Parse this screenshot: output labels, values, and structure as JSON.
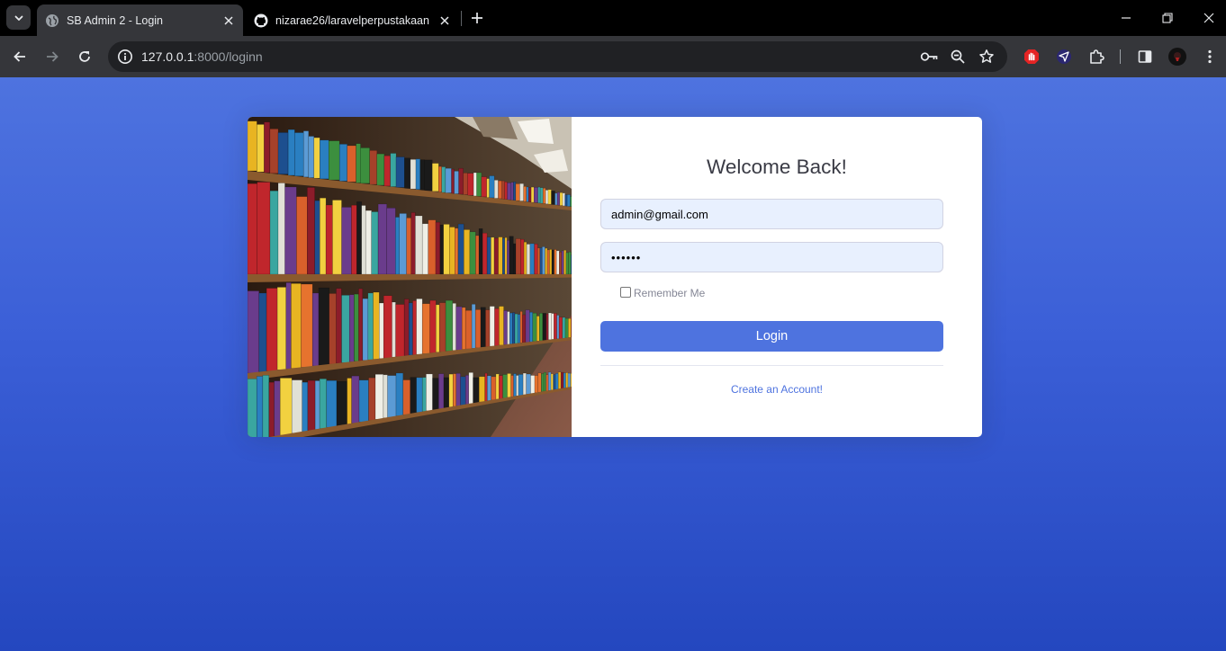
{
  "browser": {
    "tabs": [
      {
        "title": "SB Admin 2 - Login",
        "active": true,
        "favicon": "globe-icon"
      },
      {
        "title": "nizarae26/laravelperpustakaan",
        "active": false,
        "favicon": "github-icon"
      }
    ],
    "url": {
      "host": "127.0.0.1",
      "rest": ":8000/loginn"
    },
    "colors": {
      "frame": "#000000",
      "toolbar": "#35363a",
      "omnibox": "#202124"
    },
    "toolbar_icons": [
      "back-icon",
      "forward-icon",
      "reload-icon",
      "site-info-icon",
      "password-key-icon",
      "zoom-icon",
      "bookmark-star-icon",
      "adblock-extension-icon",
      "proton-vpn-extension-icon",
      "extensions-puzzle-icon",
      "side-panel-icon",
      "profile-avatar-icon",
      "more-menu-icon"
    ]
  },
  "login": {
    "heading": "Welcome Back!",
    "email_value": "admin@gmail.com",
    "password_value": "••••••",
    "remember_label": "Remember Me",
    "remember_checked": false,
    "login_button": "Login",
    "create_account_link": "Create an Account!",
    "image": "library-bookshelves-photo",
    "colors": {
      "primary": "#4e73df",
      "background_top": "#4e73df",
      "background_bottom": "#2447bf",
      "input_fill": "#e8f0fe",
      "heading": "#3a3b45"
    }
  }
}
